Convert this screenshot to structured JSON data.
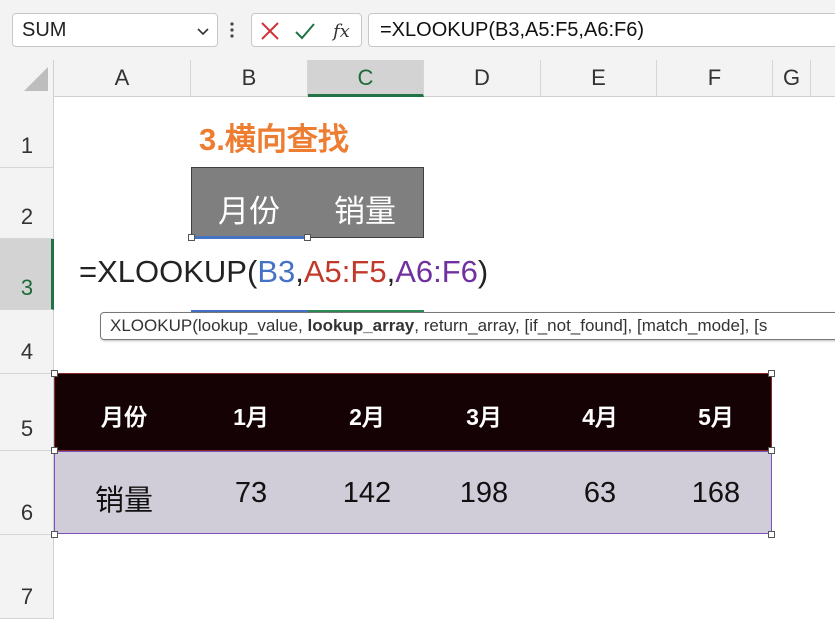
{
  "formula_bar": {
    "name_box": "SUM",
    "formula": "=XLOOKUP(B3,A5:F5,A6:F6)",
    "icons": [
      "chevron-down-icon",
      "more-vertical-icon",
      "cancel-icon",
      "enter-check-icon",
      "function-fx-icon"
    ]
  },
  "columns": [
    "A",
    "B",
    "C",
    "D",
    "E",
    "F",
    "G"
  ],
  "rows": [
    "1",
    "2",
    "3",
    "4",
    "5",
    "6",
    "7"
  ],
  "sheet": {
    "title": "3.横向查找",
    "lookup_header": [
      "月份",
      "销量"
    ],
    "cell_edit": {
      "prefix": "=XLOOKUP(",
      "arg1": "B3",
      "sep1": ",",
      "arg2": "A5:F5",
      "sep2": ",",
      "arg3": "A6:F6",
      "suffix": ")"
    },
    "tooltip": {
      "pre": "XLOOKUP(lookup_value, ",
      "bold": "lookup_array",
      "post": ", return_array, [if_not_found], [match_mode], [s"
    },
    "table": {
      "header": [
        "月份",
        "1月",
        "2月",
        "3月",
        "4月",
        "5月"
      ],
      "row": [
        "销量",
        "73",
        "142",
        "198",
        "63",
        "168"
      ]
    }
  },
  "colors": {
    "title": "#ed7d31",
    "arg_blue": "#4472c4",
    "arg_red": "#c0392b",
    "arg_purple": "#7030a0",
    "table_header_bg": "#140204",
    "table_row_bg": "#d0cdd9",
    "selection_green": "#217346"
  }
}
